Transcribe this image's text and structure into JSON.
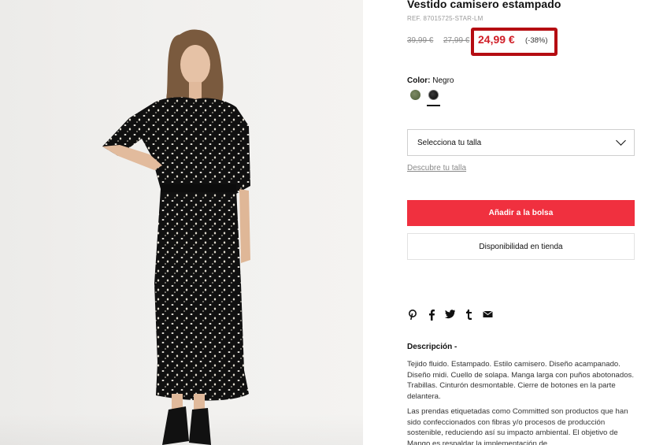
{
  "product": {
    "title": "Vestido camisero estampado",
    "ref": "REF. 87015725-STAR-LM",
    "old_price_1": "39,99 €",
    "old_price_2": "27,99 €",
    "price": "24,99 €",
    "discount": "(-38%)",
    "color_label": "Color:",
    "color_value": "Negro",
    "colors": [
      {
        "name": "green",
        "hex": "#5b6b45"
      },
      {
        "name": "black",
        "hex": "#151515",
        "selected": true
      }
    ]
  },
  "actions": {
    "size_select_label": "Selecciona tu talla",
    "size_guide": "Descubre tu talla",
    "add_to_bag": "Añadir a la bolsa",
    "store_availability": "Disponibilidad en tienda"
  },
  "share_icons": [
    "pinterest-icon",
    "facebook-icon",
    "twitter-icon",
    "tumblr-icon",
    "email-icon"
  ],
  "description": {
    "title": "Descripción -",
    "paragraphs": [
      "Tejido fluido. Estampado. Estilo camisero. Diseño acampanado. Diseño midi. Cuello de solapa. Manga larga con puños abotonados. Trabillas. Cinturón desmontable. Cierre de botones en la parte delantera.",
      "Las prendas etiquetadas como Committed son productos que han sido confeccionados con fibras y/o procesos de producción sostenible, reduciendo así su impacto ambiental. El objetivo de Mango es respaldar la implementación de"
    ]
  },
  "colors": {
    "accent_red": "#f0303f",
    "price_red": "#d01e27",
    "highlight_box": "#b50d12"
  }
}
